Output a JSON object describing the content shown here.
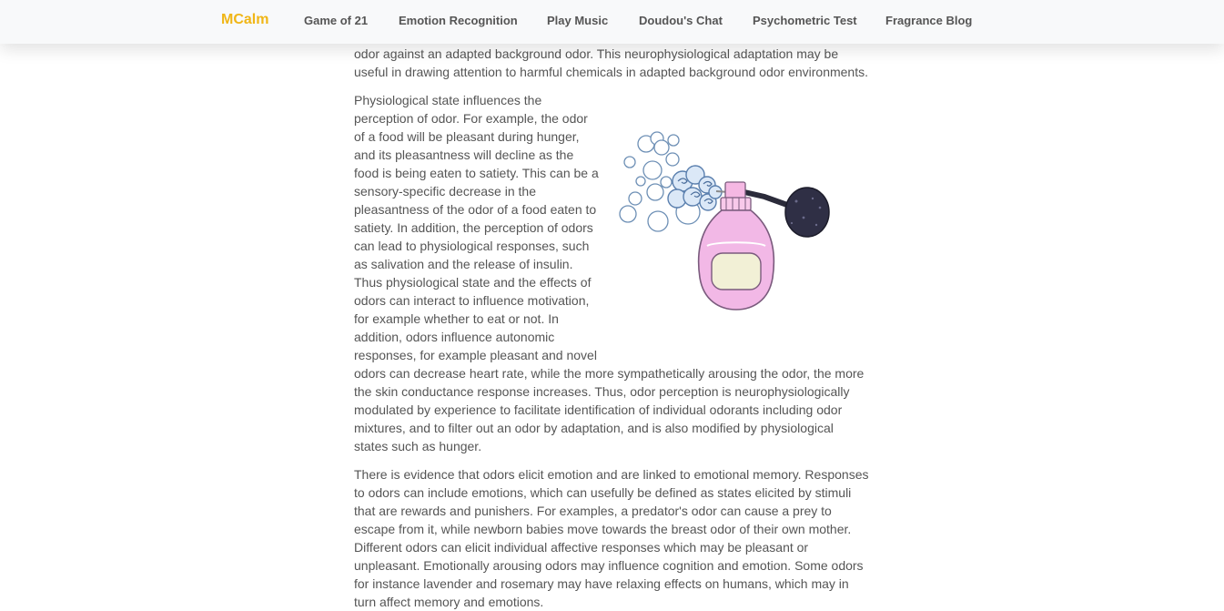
{
  "nav": {
    "brand": "MCalm",
    "links": [
      "Game of 21",
      "Emotion Recognition",
      "Play Music",
      "Doudou's Chat",
      "Psychometric Test",
      "Fragrance Blog"
    ]
  },
  "article": {
    "p1": "odor against an adapted background odor. This neurophysiological adaptation may be useful in drawing attention to harmful chemicals in adapted background odor environments.",
    "p2": "Physiological state influences the perception of odor. For example, the odor of a food will be pleasant during hunger, and its pleasantness will decline as the food is being eaten to satiety. This can be a sensory-specific decrease in the pleasantness of the odor of a food eaten to satiety. In addition, the perception of odors can lead to physiological responses, such as salivation and the release of insulin. Thus physiological state and the effects of odors can interact to influence motivation, for example whether to eat or not. In addition, odors influence autonomic responses, for example pleasant and novel odors can decrease heart rate, while the more sympathetically arousing the odor, the more the skin conductance response increases. Thus, odor perception is neurophysiologically modulated by experience to facilitate identification of individual odorants including odor mixtures, and to filter out an odor by adaptation, and is also modified by physiological states such as hunger.",
    "p3": "There is evidence that odors elicit emotion and are linked to emotional memory. Responses to odors can include emotions, which can usefully be defined as states elicited by stimuli that are rewards and punishers. For examples, a predator's odor can cause a prey to escape from it, while newborn babies move towards the breast odor of their own mother. Different odors can elicit individual affective responses which may be pleasant or unpleasant. Emotionally arousing odors may influence cognition and emotion. Some odors for instance lavender and rosemary may have relaxing effects on humans, which may in turn affect memory and emotions."
  },
  "illustration": {
    "icon": "perfume-atomizer-illustration",
    "bottle_color": "#f2b8e6",
    "label_color": "#f2f0d6",
    "bulb_color": "#2f2f45",
    "cloud_color": "#8fb8e6"
  }
}
